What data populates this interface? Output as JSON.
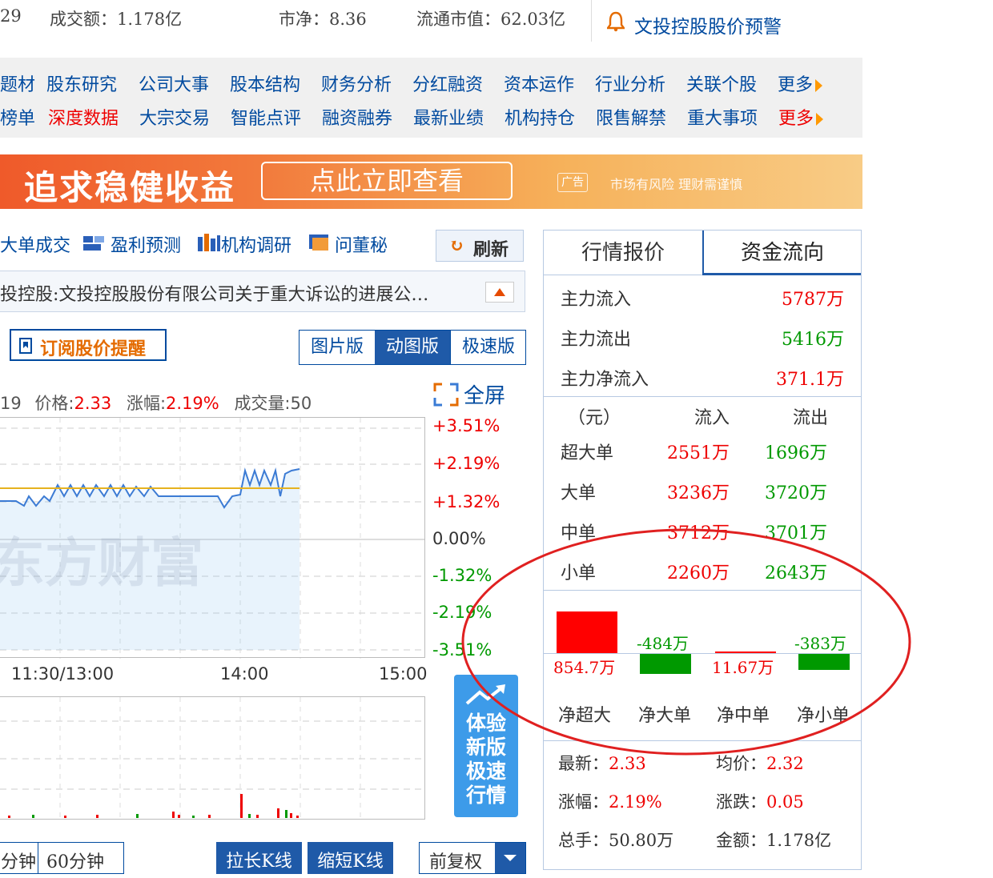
{
  "top_info": {
    "left_num": "29",
    "turnover": "成交额：1.178亿",
    "pb": "市净：8.36",
    "float_cap": "流通市值：62.03亿",
    "alert": "文投控股股价预警"
  },
  "nav": {
    "row1": [
      "题材",
      "股东研究",
      "公司大事",
      "股本结构",
      "财务分析",
      "分红融资",
      "资本运作",
      "行业分析",
      "关联个股",
      "更多"
    ],
    "row2": [
      "榜单",
      "深度数据",
      "大宗交易",
      "智能点评",
      "融资融券",
      "最新业绩",
      "机构持仓",
      "限售解禁",
      "重大事项",
      "更多"
    ]
  },
  "banner": {
    "headline": "追求稳健收益",
    "cta": "点此立即查看",
    "ad_tag": "广告",
    "disclaimer": "市场有风险 理财需谨慎"
  },
  "toolbar": {
    "items": [
      "大单成交",
      "盈利预测",
      "机构调研",
      "问董秘"
    ],
    "refresh": "刷新"
  },
  "notice": "投控股:文投控股股份有限公司关于重大诉讼的进展公…",
  "subscribe": "订阅股价提醒",
  "modes": [
    "图片版",
    "动图版",
    "极速版"
  ],
  "fullscreen": "全屏",
  "chart_header": {
    "time_prefix": "19",
    "price_label": "价格:",
    "price": "2.33",
    "change_label": "涨幅:",
    "change": "2.19%",
    "volume": "成交量:50"
  },
  "chart_data": {
    "type": "line",
    "y_ticks": [
      "+3.51%",
      "+2.19%",
      "+1.32%",
      "0.00%",
      "-1.32%",
      "-2.19%",
      "-3.51%"
    ],
    "x_ticks": [
      "11:30/13:00",
      "14:00",
      "15:00"
    ],
    "ylim": [
      -3.51,
      3.51
    ],
    "watermark": "东方财富"
  },
  "try_fast": "体验新版极速行情",
  "bottom_buttons": {
    "min": "分钟",
    "min60": "60分钟",
    "longer": "拉长K线",
    "shorter": "缩短K线",
    "adjust": "前复权"
  },
  "panel": {
    "tabs": [
      "行情报价",
      "资金流向"
    ],
    "main": [
      {
        "label": "主力流入",
        "value": "5787万",
        "color": "red"
      },
      {
        "label": "主力流出",
        "value": "5416万",
        "color": "green"
      },
      {
        "label": "主力净流入",
        "value": "371.1万",
        "color": "red"
      }
    ],
    "table_head": [
      "（元）",
      "流入",
      "流出"
    ],
    "table": [
      {
        "label": "超大单",
        "in": "2551万",
        "out": "1696万"
      },
      {
        "label": "大单",
        "in": "3236万",
        "out": "3720万"
      },
      {
        "label": "中单",
        "in": "3712万",
        "out": "3701万"
      },
      {
        "label": "小单",
        "in": "2260万",
        "out": "2643万"
      }
    ],
    "net_bars": [
      {
        "label": "净超大",
        "value": "854.7万",
        "sign": "pos"
      },
      {
        "label": "净大单",
        "value": "-484万",
        "sign": "neg"
      },
      {
        "label": "净中单",
        "value": "11.67万",
        "sign": "pos"
      },
      {
        "label": "净小单",
        "value": "-383万",
        "sign": "neg"
      }
    ],
    "stats": {
      "latest_label": "最新：",
      "latest": "2.33",
      "avg_label": "均价：",
      "avg": "2.32",
      "chg_label": "涨幅：",
      "chg": "2.19%",
      "diff_label": "涨跌：",
      "diff": "0.05",
      "vol_label": "总手：",
      "vol": "50.80万",
      "amt_label": "金额：",
      "amt": "1.178亿"
    }
  },
  "colors": {
    "link": "#004a9f",
    "up": "#ee0000",
    "down": "#009900",
    "annotation": "#e02020"
  }
}
